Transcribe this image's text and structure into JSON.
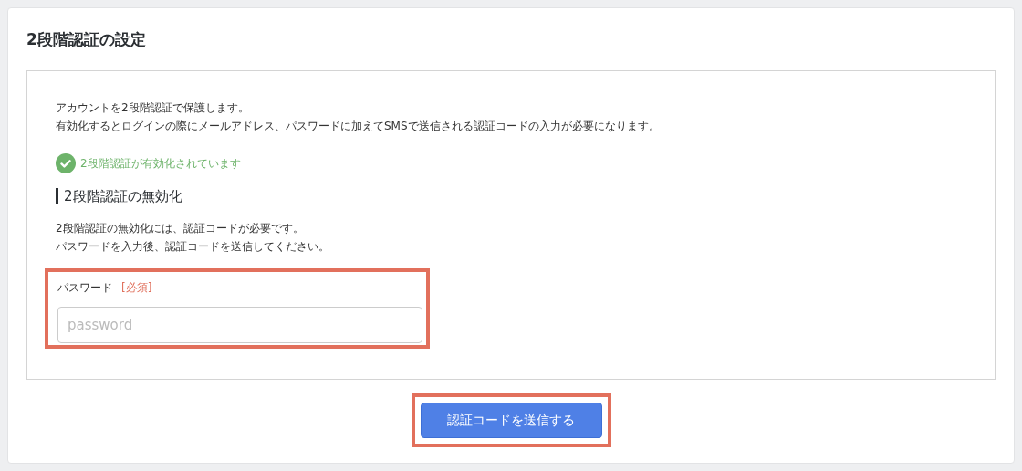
{
  "title": "2段階認証の設定",
  "intro": [
    "アカウントを2段階認証で保護します。",
    "有効化するとログインの際にメールアドレス、パスワードに加えてSMSで送信される認証コードの入力が必要になります。"
  ],
  "status": {
    "enabled": true,
    "text": "2段階認証が有効化されています"
  },
  "section": {
    "heading": "2段階認証の無効化",
    "lines": [
      "2段階認証の無効化には、認証コードが必要です。",
      "パスワードを入力後、認証コードを送信してください。"
    ]
  },
  "field": {
    "label": "パスワード",
    "required": "[必須]",
    "placeholder": "password",
    "highlighted": true
  },
  "button": {
    "label": "認証コードを送信する",
    "highlighted": true
  }
}
